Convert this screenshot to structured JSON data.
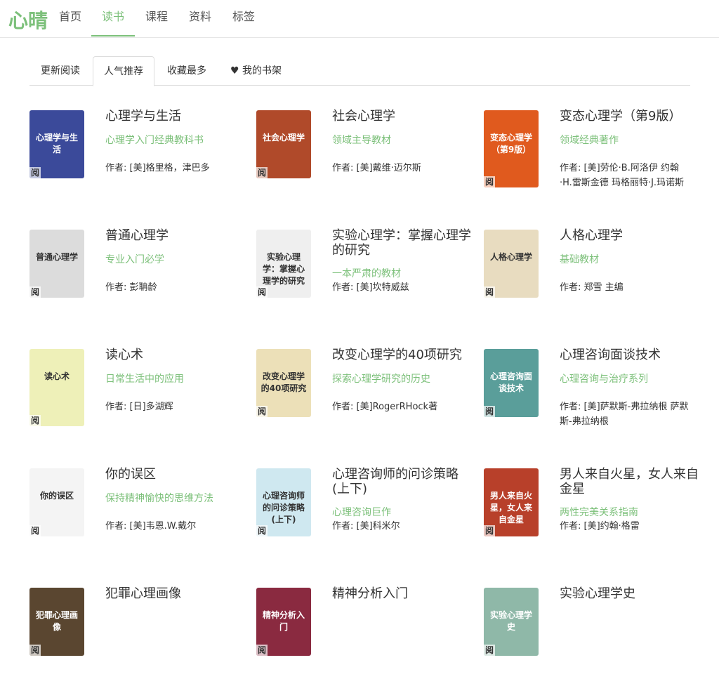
{
  "logo": "心晴",
  "nav": [
    "首页",
    "读书",
    "课程",
    "资料",
    "标签"
  ],
  "tabs": [
    "更新阅读",
    "人气推荐",
    "收藏最多",
    "我的书架"
  ],
  "badge": "阅",
  "books": [
    {
      "title": "心理学与生活",
      "sub": "心理学入门经典教科书",
      "author": "作者: [美]格里格，津巴多",
      "color": "#3b4a9a"
    },
    {
      "title": "社会心理学",
      "sub": "领域主导教材",
      "author": "作者: [美]戴维·迈尔斯",
      "color": "#b04a2a"
    },
    {
      "title": "变态心理学（第9版）",
      "sub": "领域经典著作",
      "author": "作者: [美]劳伦·B.阿洛伊 约翰·H.雷斯金德 玛格丽特·J.玛诺斯",
      "color": "#e05a1e"
    },
    {
      "title": "普通心理学",
      "sub": "专业入门必学",
      "author": "作者: 彭聃龄",
      "color": "#dcdcdc"
    },
    {
      "title": "实验心理学：掌握心理学的研究",
      "sub": "一本严肃的教材",
      "author": "作者: [美]坎特威兹",
      "color": "#efefef"
    },
    {
      "title": "人格心理学",
      "sub": "基础教材",
      "author": "作者: 郑雪 主编",
      "color": "#e8dcc0"
    },
    {
      "title": "读心术",
      "sub": "日常生活中的应用",
      "author": "作者: [日]多湖辉",
      "color": "#eef0b8"
    },
    {
      "title": "改变心理学的40项研究",
      "sub": "探索心理学研究的历史",
      "author": "作者: [美]RogerRHock著",
      "color": "#ece0b8"
    },
    {
      "title": "心理咨询面谈技术",
      "sub": "心理咨询与治疗系列",
      "author": "作者: [美]萨默斯-弗拉纳根 萨默斯-弗拉纳根",
      "color": "#5a9e9a"
    },
    {
      "title": "你的误区",
      "sub": "保持精神愉快的思维方法",
      "author": "作者: [美]韦恩.W.戴尔",
      "color": "#f4f4f4"
    },
    {
      "title": "心理咨询师的问诊策略(上下)",
      "sub": "心理咨询巨作",
      "author": "作者: [美]科米尔",
      "color": "#cfe8f0"
    },
    {
      "title": "男人来自火星，女人来自金星",
      "sub": "两性完美关系指南",
      "author": "作者: [美]约翰·格雷",
      "color": "#b8402a"
    },
    {
      "title": "犯罪心理画像",
      "sub": "",
      "author": "",
      "color": "#5a4630"
    },
    {
      "title": "精神分析入门",
      "sub": "",
      "author": "",
      "color": "#8a2a40"
    },
    {
      "title": "实验心理学史",
      "sub": "",
      "author": "",
      "color": "#8fb8a8"
    }
  ]
}
